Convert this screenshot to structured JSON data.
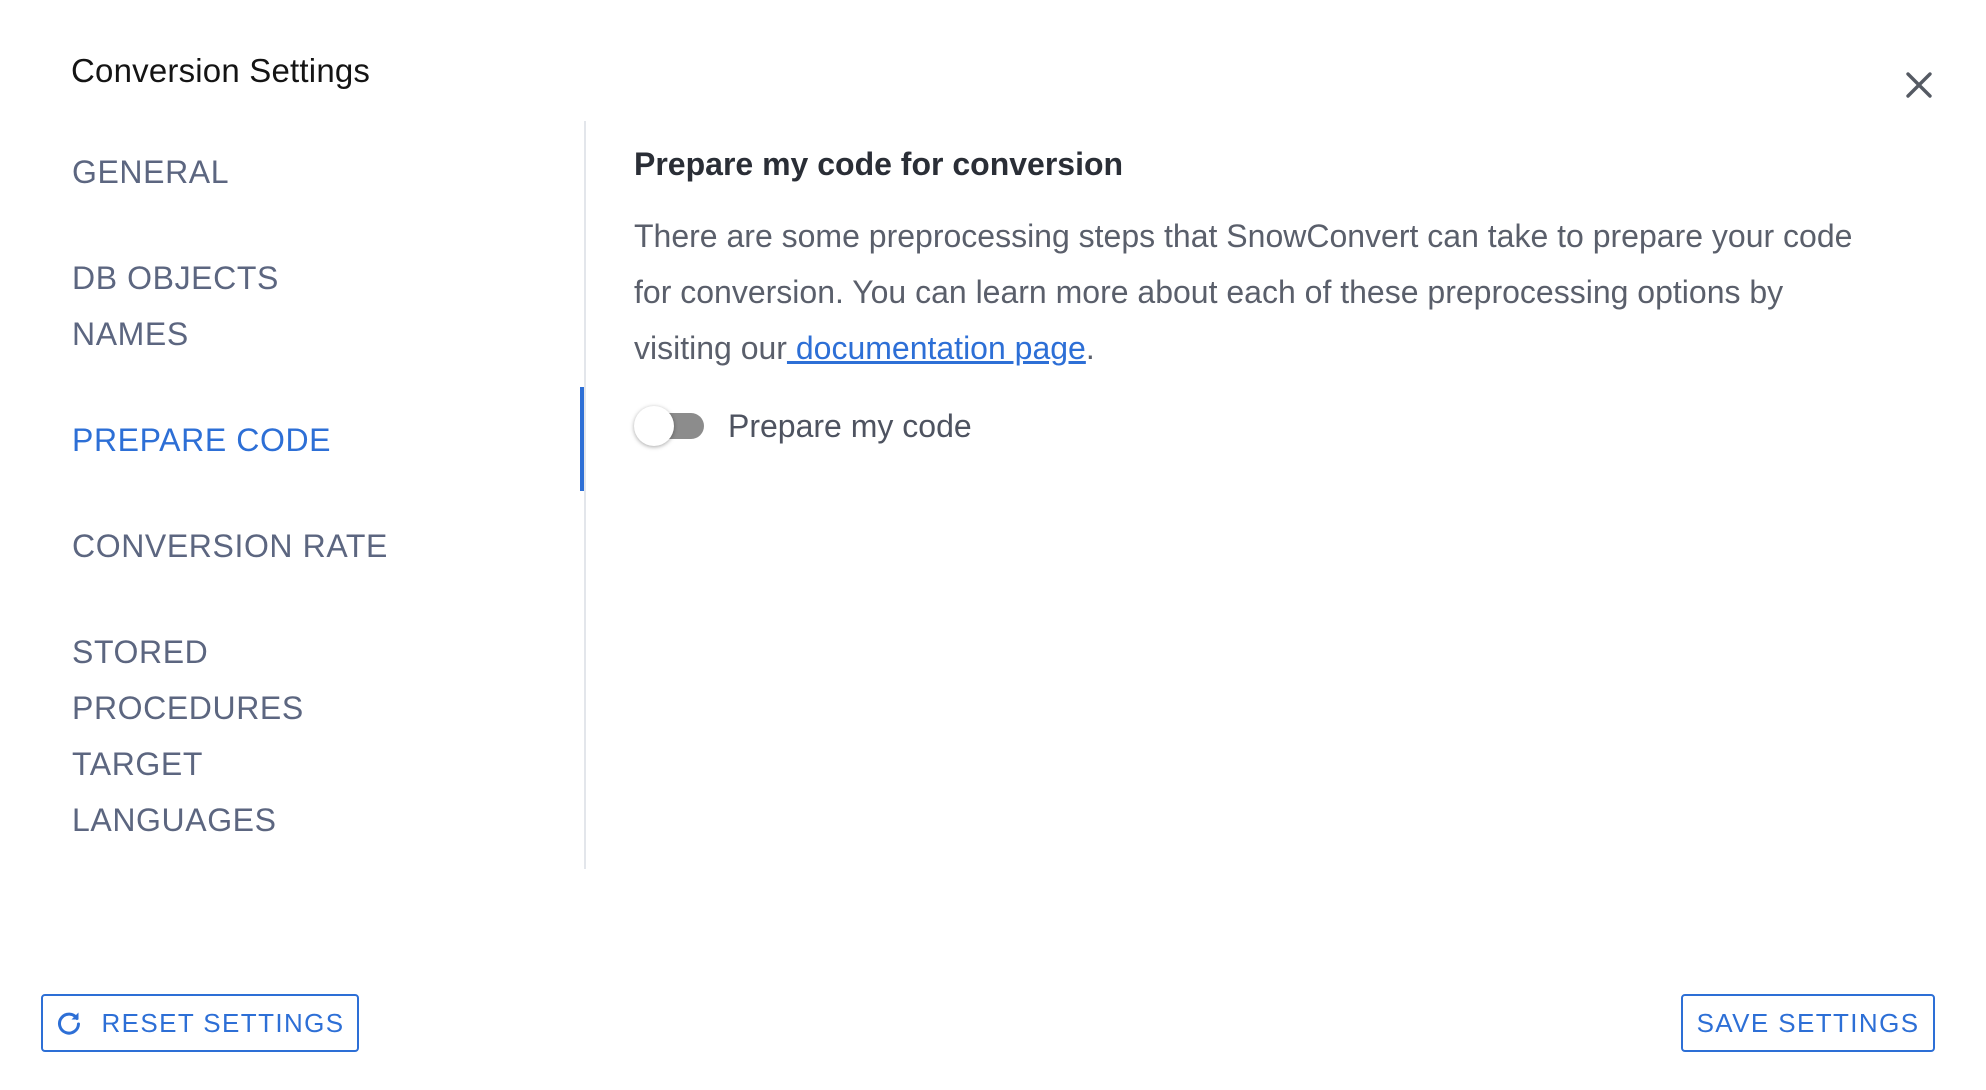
{
  "dialog": {
    "title": "Conversion Settings",
    "close_icon": "close-icon"
  },
  "sidebar": {
    "items": [
      {
        "label": "GENERAL",
        "active": false
      },
      {
        "label": "DB OBJECTS NAMES",
        "active": false
      },
      {
        "label": "PREPARE CODE",
        "active": true
      },
      {
        "label": "CONVERSION RATE",
        "active": false
      },
      {
        "label": "STORED PROCEDURES TARGET LANGUAGES",
        "active": false
      }
    ],
    "item_lines": {
      "general": "GENERAL",
      "db_objects_line1": "DB OBJECTS",
      "db_objects_line2": "NAMES",
      "prepare_code": "PREPARE CODE",
      "conversion_rate": "CONVERSION RATE",
      "stored_line1": "STORED",
      "stored_line2": "PROCEDURES",
      "stored_line3": "TARGET",
      "stored_line4": "LANGUAGES"
    }
  },
  "content": {
    "title": "Prepare my code for conversion",
    "description_before_link": "There are some preprocessing steps that SnowConvert can take to prepare your code for conversion. You can learn more about each of these preprocessing options by visiting our",
    "link_text": " documentation page",
    "description_after_link": ".",
    "toggle": {
      "label": "Prepare my code",
      "checked": false
    }
  },
  "footer": {
    "reset_label": "RESET SETTINGS",
    "reset_icon": "refresh-icon",
    "save_label": "SAVE SETTINGS"
  },
  "colors": {
    "accent": "#2d6fd6",
    "nav_text": "#5c6680",
    "body_text": "#5a5f6b",
    "divider": "#e3e6eb",
    "toggle_track_off": "#8c8c8c"
  }
}
